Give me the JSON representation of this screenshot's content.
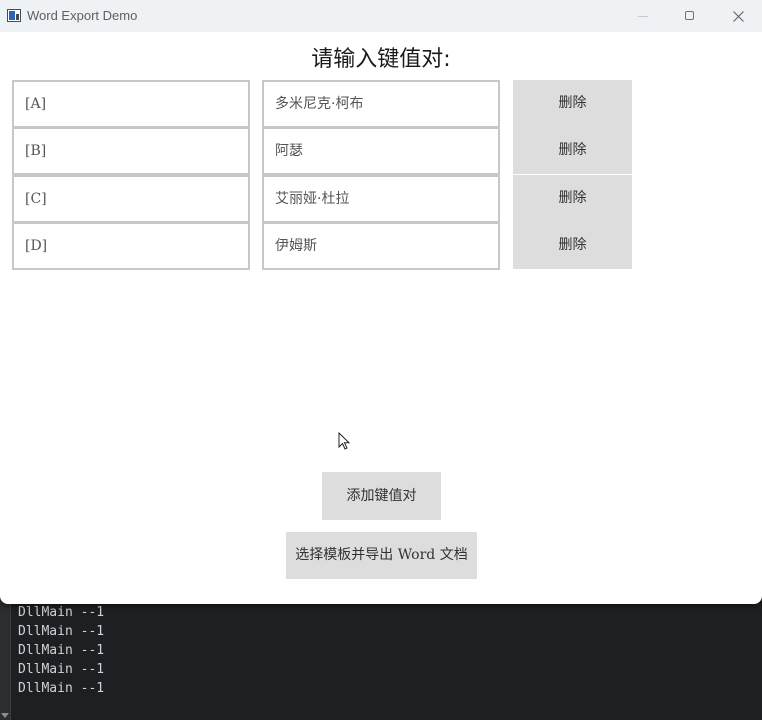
{
  "window": {
    "title": "Word Export Demo"
  },
  "main": {
    "heading": "请输入键值对:",
    "rows": [
      {
        "key": "[A]",
        "value": "多米尼克·柯布",
        "delete_label": "删除"
      },
      {
        "key": "[B]",
        "value": "阿瑟",
        "delete_label": "删除"
      },
      {
        "key": "[C]",
        "value": "艾丽娅·杜拉",
        "delete_label": "删除"
      },
      {
        "key": "[D]",
        "value": "伊姆斯",
        "delete_label": "删除"
      }
    ],
    "add_button_label": "添加键值对",
    "export_button_label": "选择模板并导出 Word 文档"
  },
  "console": {
    "lines": [
      "DllMain --1",
      "DllMain --1",
      "DllMain --1",
      "DllMain --1",
      "DllMain --1"
    ]
  },
  "colors": {
    "window_bg": "#ffffff",
    "titlebar_bg": "#eff2f5",
    "button_bg": "#dddddd",
    "field_border": "#c8c8c8",
    "console_bg": "#1e1f22",
    "console_text": "#cfd2d6"
  },
  "icons": {
    "app": "word-export-app-icon",
    "minimize": "minimize-icon",
    "maximize": "maximize-icon",
    "close": "close-icon",
    "cursor": "mouse-pointer-icon"
  }
}
